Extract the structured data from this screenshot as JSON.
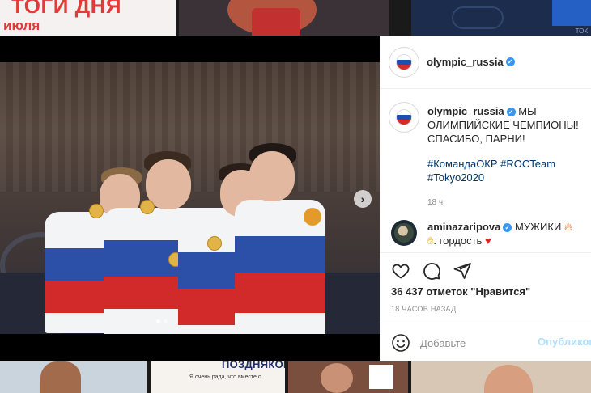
{
  "background_feed": {
    "top_left_title": "ТОГИ ДНЯ",
    "top_left_sub": "июля",
    "top_right_tag": "ТОК",
    "bottom_middle_title": "ПОЗДНЯКОВА",
    "bottom_middle_line": "Я очень рада, что вместе с"
  },
  "carousel": {
    "next_icon": "chevron-right-icon",
    "dots_total": 2,
    "active_index": 0
  },
  "post": {
    "author": "olympic_russia",
    "caption": "МЫ ОЛИМПИЙСКИЕ ЧЕМПИОНЫ! СПАСИБО, ПАРНИ!",
    "hashtags": "#КомандаОКР #ROCTeam #Tokyo2020",
    "time_ago": "18 ч.",
    "comment_author": "aminazaripova",
    "comment_text": "МУЖИКИ",
    "comment_text2": "гордость",
    "likes": "36 437 отметок \"Нравится\"",
    "posted_ago": "18 ЧАСОВ НАЗАД",
    "comment_placeholder": "Добавьте",
    "post_button": "Опубликов",
    "colors": {
      "link": "#00376b",
      "verified": "#3897f0",
      "muted": "#8e8e8e"
    }
  }
}
